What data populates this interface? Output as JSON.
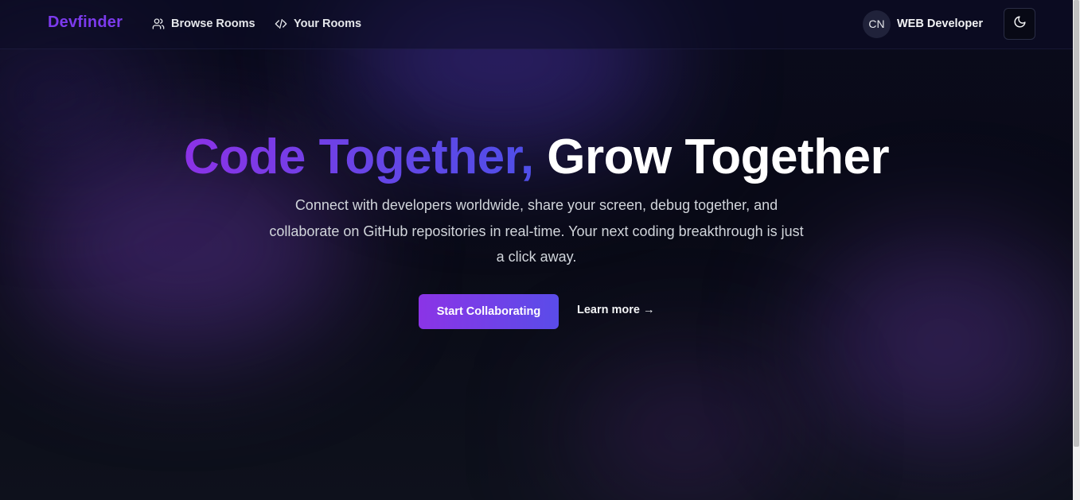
{
  "header": {
    "brand": "Devfinder",
    "nav": [
      {
        "label": "Browse Rooms",
        "icon": "users-icon"
      },
      {
        "label": "Your Rooms",
        "icon": "code-icon"
      }
    ],
    "user": {
      "initials": "CN",
      "name": "WEB Developer"
    },
    "theme_toggle_icon": "moon-icon"
  },
  "hero": {
    "title_gradient": "Code Together,",
    "title_plain": "Grow Together",
    "subtitle": "Connect with developers worldwide, share your screen, debug together, and collaborate on GitHub repositories in real-time. Your next coding breakthrough is just a click away.",
    "primary_cta": "Start Collaborating",
    "secondary_cta": "Learn more",
    "secondary_cta_arrow": "→"
  },
  "colors": {
    "brand": "#7c3aed",
    "gradient_start": "#8b32e6",
    "gradient_end": "#4f4ee8",
    "background": "#0b0d17"
  }
}
